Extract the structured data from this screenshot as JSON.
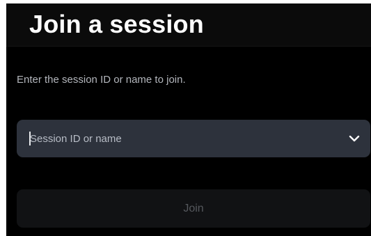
{
  "header": {
    "title": "Join a session"
  },
  "main": {
    "instruction": "Enter the session ID or name to join.",
    "session_field": {
      "placeholder": "Session ID or name",
      "value": "",
      "icon": "chevron-down-icon"
    },
    "join_button": {
      "label": "Join",
      "enabled": false
    }
  },
  "colors": {
    "background": "#000000",
    "header_background": "#0b0b0b",
    "field_background": "#2d323c",
    "button_background_disabled": "#111214",
    "button_text_disabled": "#55585d",
    "title_text": "#ffffff",
    "secondary_text": "#b3b6bc"
  }
}
